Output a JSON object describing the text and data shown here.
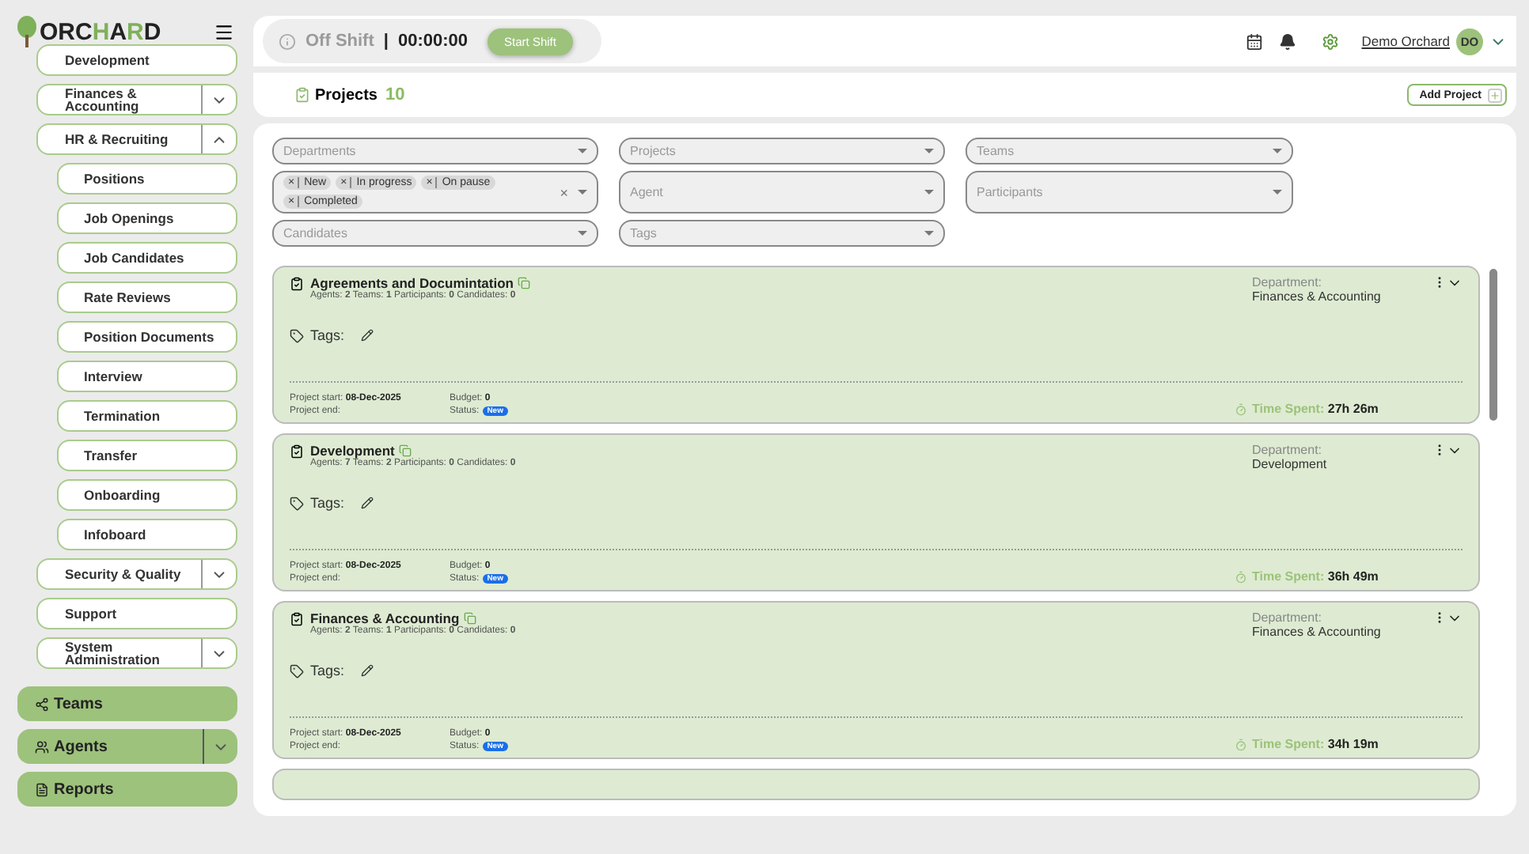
{
  "logo": [
    {
      "text": "ORC",
      "accent": false
    },
    {
      "text": "H",
      "accent": true
    },
    {
      "text": "A",
      "accent": false
    },
    {
      "text": "R",
      "accent": true
    },
    {
      "text": "D",
      "accent": false
    }
  ],
  "sidebar": {
    "items": [
      {
        "label": "Development",
        "expandable": false
      },
      {
        "label": "Finances & Accounting",
        "expandable": true,
        "expanded": false
      },
      {
        "label": "HR & Recruiting",
        "expandable": true,
        "expanded": true,
        "children": [
          {
            "label": "Positions"
          },
          {
            "label": "Job Openings"
          },
          {
            "label": "Job Candidates"
          },
          {
            "label": "Rate Reviews"
          },
          {
            "label": "Position Documents"
          },
          {
            "label": "Interview"
          },
          {
            "label": "Termination"
          },
          {
            "label": "Transfer"
          },
          {
            "label": "Onboarding"
          },
          {
            "label": "Infoboard"
          }
        ]
      },
      {
        "label": "Security & Quality",
        "expandable": true,
        "expanded": false
      },
      {
        "label": "Support",
        "expandable": false
      },
      {
        "label": "System Administration",
        "expandable": true,
        "expanded": false
      }
    ],
    "nav": [
      {
        "label": "Teams",
        "expandable": false
      },
      {
        "label": "Agents",
        "expandable": true
      },
      {
        "label": "Reports",
        "expandable": false
      }
    ]
  },
  "shift": {
    "status": "Off Shift",
    "separator": "|",
    "timer": "00:00:00",
    "button": "Start Shift"
  },
  "user": {
    "name": "Demo Orchard",
    "initials": "DO"
  },
  "page": {
    "title": "Projects",
    "count": "10",
    "add_button": "Add Project"
  },
  "filters": [
    {
      "placeholder": "Departments"
    },
    {
      "placeholder": "Projects"
    },
    {
      "placeholder": "Teams"
    },
    {
      "chips": [
        {
          "remove": "×",
          "label": "New"
        },
        {
          "remove": "×",
          "label": "In progress"
        },
        {
          "remove": "×",
          "label": "On pause"
        },
        {
          "remove": "×",
          "label": "Completed"
        }
      ],
      "clear": "×"
    },
    {
      "placeholder": "Agent"
    },
    {
      "placeholder": "Participants"
    },
    {
      "placeholder": "Candidates"
    },
    {
      "placeholder": "Tags"
    }
  ],
  "projects": [
    {
      "title": "Agreements and Documintation",
      "counts": "Agents: **2** Teams: **1** Participants: **0** Candidates: **0**",
      "department_label": "Department:",
      "department": "Finances & Accounting",
      "tags_label": "Tags:",
      "start_label": "Project start:",
      "start": "08-Dec-2025",
      "end_label": "Project end:",
      "budget_label": "Budget:",
      "budget": "0",
      "status_label": "Status:",
      "status": "New",
      "time_label": "Time Spent:",
      "time": "27h 26m"
    },
    {
      "title": "Development",
      "counts": "Agents: **7** Teams: **2** Participants: **0** Candidates: **0**",
      "department_label": "Department:",
      "department": "Development",
      "tags_label": "Tags:",
      "start_label": "Project start:",
      "start": "08-Dec-2025",
      "end_label": "Project end:",
      "budget_label": "Budget:",
      "budget": "0",
      "status_label": "Status:",
      "status": "New",
      "time_label": "Time Spent:",
      "time": "36h 49m"
    },
    {
      "title": "Finances & Accounting",
      "counts": "Agents: **2** Teams: **1** Participants: **0** Candidates: **0**",
      "department_label": "Department:",
      "department": "Finances & Accounting",
      "tags_label": "Tags:",
      "start_label": "Project start:",
      "start": "08-Dec-2025",
      "end_label": "Project end:",
      "budget_label": "Budget:",
      "budget": "0",
      "status_label": "Status:",
      "status": "New",
      "time_label": "Time Spent:",
      "time": "34h 19m"
    }
  ]
}
